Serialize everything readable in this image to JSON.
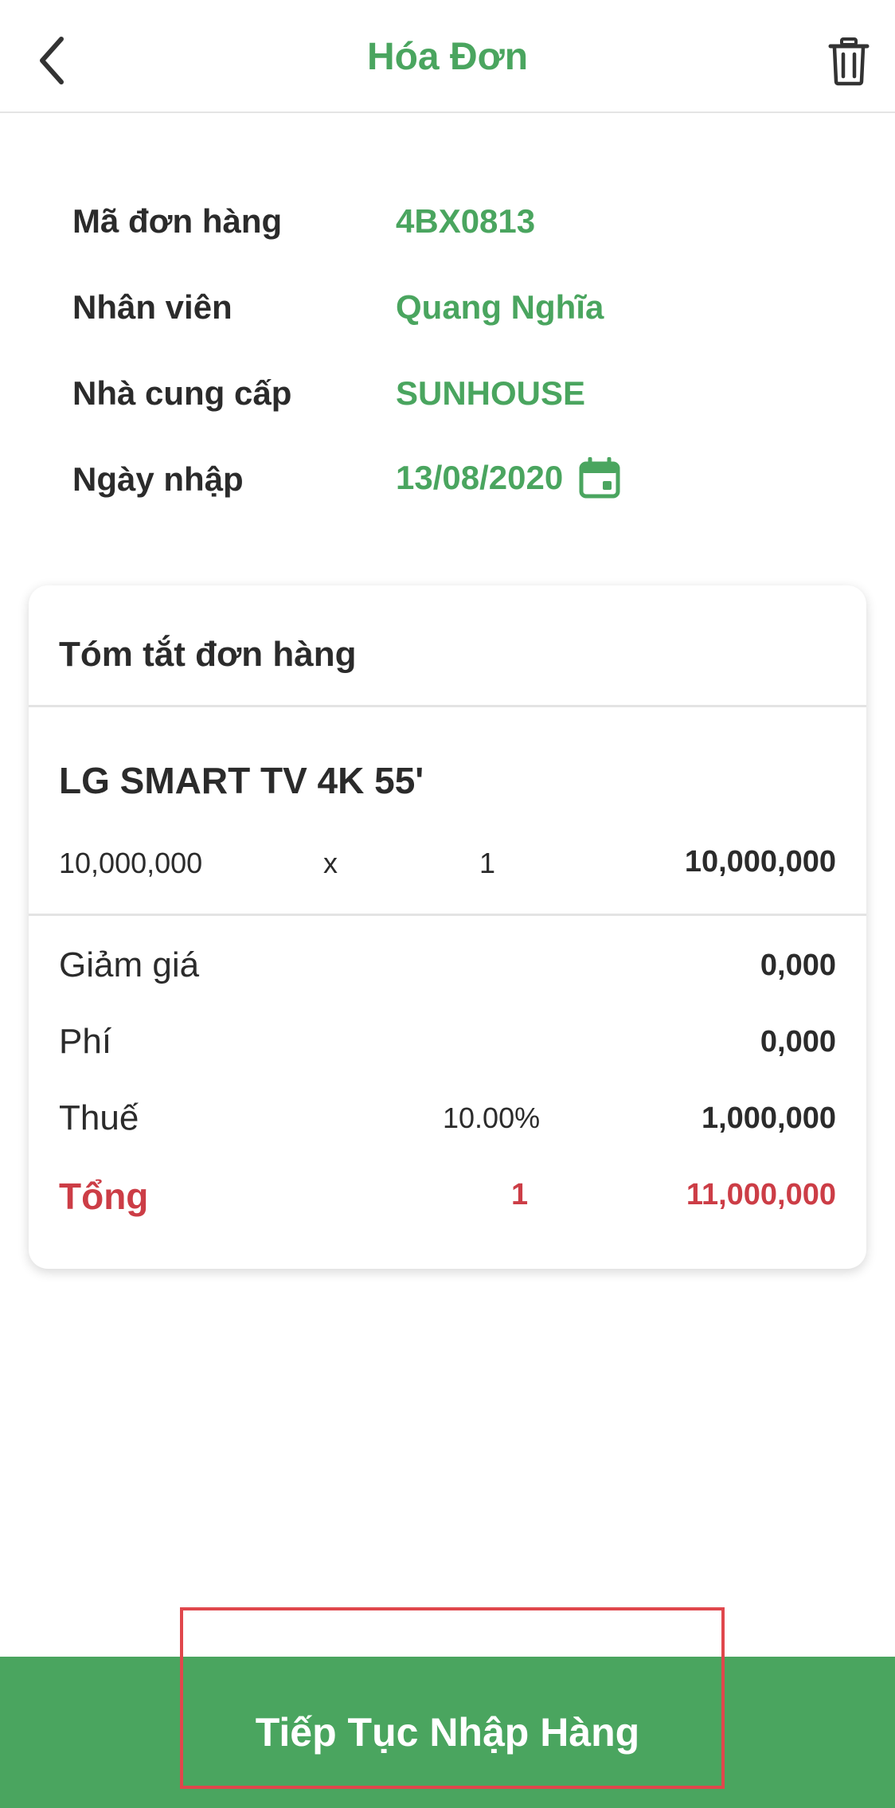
{
  "header": {
    "title": "Hóa Đơn",
    "back_icon": "chevron-left-icon",
    "trash_icon": "trash-icon"
  },
  "info": {
    "order_code": {
      "label": "Mã đơn hàng",
      "value": "4BX0813"
    },
    "employee": {
      "label": "Nhân viên",
      "value": "Quang Nghĩa"
    },
    "supplier": {
      "label": "Nhà cung cấp",
      "value": "SUNHOUSE"
    },
    "import_date": {
      "label": "Ngày nhập",
      "value": "13/08/2020",
      "icon": "calendar-icon"
    }
  },
  "summary": {
    "title": "Tóm tắt đơn hàng",
    "product": {
      "name": "LG SMART TV 4K 55'",
      "unit_price": "10,000,000",
      "times": "x",
      "quantity": "1",
      "line_total": "10,000,000"
    },
    "discount": {
      "label": "Giảm giá",
      "value": "0,000"
    },
    "fee": {
      "label": "Phí",
      "value": "0,000"
    },
    "tax": {
      "label": "Thuế",
      "rate": "10.00%",
      "value": "1,000,000"
    },
    "total": {
      "label": "Tổng",
      "count": "1",
      "value": "11,000,000"
    }
  },
  "footer": {
    "continue_label": "Tiếp Tục Nhập Hàng"
  },
  "colors": {
    "accent": "#4aa55f",
    "total": "#cc3d46",
    "highlight": "#e0474c"
  }
}
